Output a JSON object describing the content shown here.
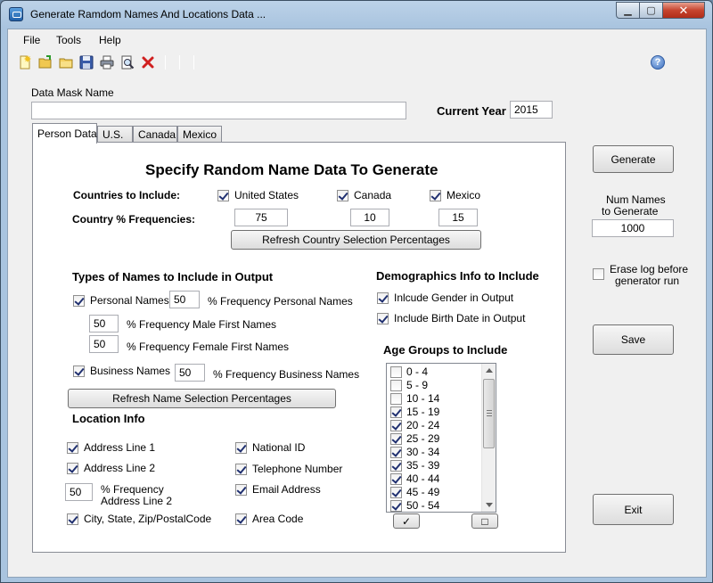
{
  "window": {
    "title": "Generate Ramdom Names And Locations Data ..."
  },
  "menu": [
    "File",
    "Tools",
    "Help"
  ],
  "toolbar": {
    "icons": [
      "new-icon",
      "open-icon",
      "folder-icon",
      "save-icon",
      "print-icon",
      "print-preview-icon",
      "delete-icon"
    ],
    "help_icon": "help-icon"
  },
  "mask": {
    "label": "Data Mask Name",
    "value": ""
  },
  "current_year": {
    "label": "Current Year",
    "value": "2015"
  },
  "tabs": [
    "Person Data",
    "U.S.",
    "Canada",
    "Mexico"
  ],
  "person": {
    "heading": "Specify Random Name Data To Generate",
    "countries_label": "Countries to Include:",
    "freq_label": "Country % Frequencies:",
    "countries": [
      {
        "name": "United States",
        "checked": true,
        "freq": "75"
      },
      {
        "name": "Canada",
        "checked": true,
        "freq": "10"
      },
      {
        "name": "Mexico",
        "checked": true,
        "freq": "15"
      }
    ],
    "refresh_country_btn": "Refresh Country Selection Percentages",
    "types_heading": "Types of Names  to Include in Output",
    "personal_names": {
      "label": "Personal Names",
      "checked": true,
      "value": "50",
      "suffix": "% Frequency Personal Names"
    },
    "male_first": {
      "value": "50",
      "label": "% Frequency Male First Names"
    },
    "female_first": {
      "value": "50",
      "label": "% Frequency Female First Names"
    },
    "business_names": {
      "label": "Business Names",
      "checked": true,
      "value": "50",
      "suffix": "% Frequency Business Names"
    },
    "refresh_names_btn": "Refresh Name Selection Percentages",
    "location_heading": "Location  Info",
    "location": {
      "address1": {
        "label": "Address Line 1",
        "checked": true
      },
      "address2": {
        "label": "Address Line 2",
        "checked": true
      },
      "address2_freq": {
        "value": "50",
        "line1": "% Frequency",
        "line2": "Address Line 2"
      },
      "city": {
        "label": "City, State, Zip/PostalCode",
        "checked": true
      },
      "national_id": {
        "label": "National ID",
        "checked": true
      },
      "telephone": {
        "label": "Telephone Number",
        "checked": true
      },
      "email": {
        "label": "Email Address",
        "checked": true
      },
      "area_code": {
        "label": "Area Code",
        "checked": true
      }
    },
    "demo_heading": "Demographics Info to Include",
    "demo": [
      {
        "label": "Inlcude Gender in Output",
        "checked": true
      },
      {
        "label": "Include Birth Date in Output",
        "checked": true
      }
    ],
    "age_heading": "Age Groups  to Include",
    "age_groups": [
      {
        "label": "0 - 4",
        "checked": false
      },
      {
        "label": "5 - 9",
        "checked": false
      },
      {
        "label": "10 - 14",
        "checked": false
      },
      {
        "label": "15 - 19",
        "checked": true
      },
      {
        "label": "20 - 24",
        "checked": true
      },
      {
        "label": "25 - 29",
        "checked": true
      },
      {
        "label": "30 - 34",
        "checked": true
      },
      {
        "label": "35 - 39",
        "checked": true
      },
      {
        "label": "40 - 44",
        "checked": true
      },
      {
        "label": "45 - 49",
        "checked": true
      },
      {
        "label": "50 - 54",
        "checked": true
      }
    ],
    "select_all_symbol": "✓",
    "clear_all_symbol": "□"
  },
  "right": {
    "generate_btn": "Generate",
    "num_label_1": "Num Names",
    "num_label_2": "to Generate",
    "num_value": "1000",
    "erase_label_1": "Erase log before",
    "erase_label_2": "generator run",
    "erase_checked": false,
    "save_btn": "Save",
    "exit_btn": "Exit"
  }
}
